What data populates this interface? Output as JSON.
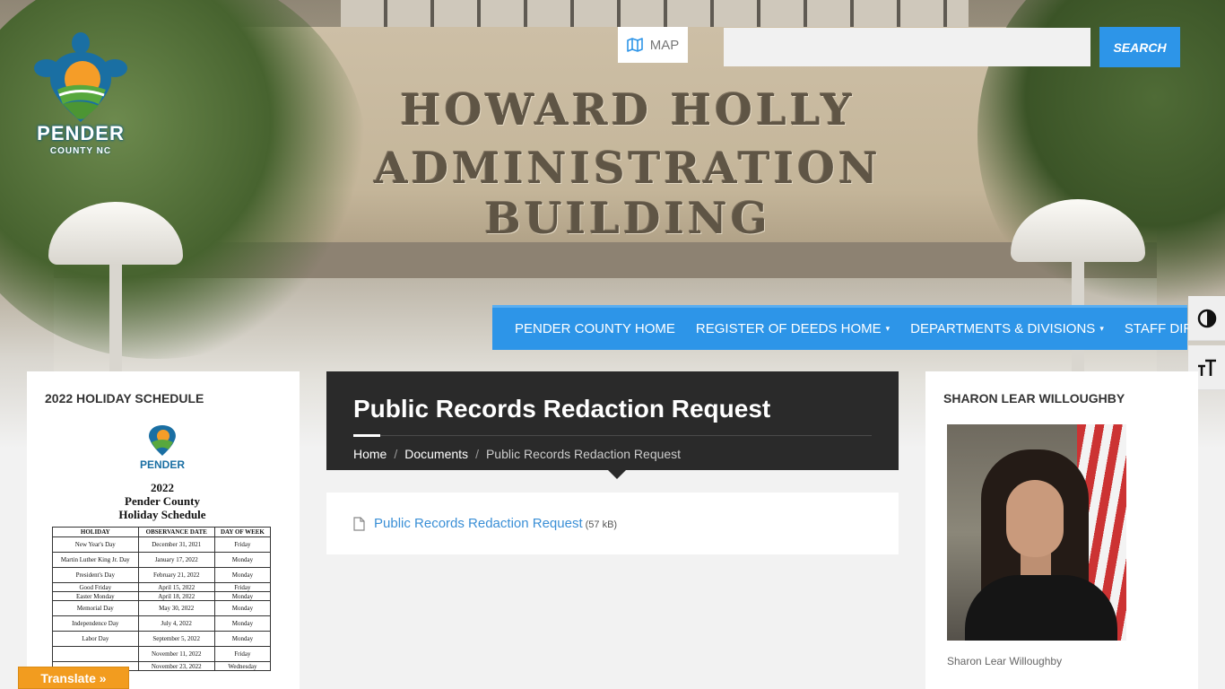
{
  "header": {
    "logo_text": "PENDER",
    "logo_subtext": "COUNTY NC",
    "building_line1": "HOWARD HOLLY",
    "building_line2": "ADMINISTRATION BUILDING",
    "map_label": "MAP",
    "search_placeholder": "",
    "search_button": "SEARCH"
  },
  "nav": {
    "items": [
      {
        "label": "PENDER COUNTY HOME"
      },
      {
        "label": "REGISTER OF DEEDS HOME"
      },
      {
        "label": "DEPARTMENTS & DIVISIONS"
      },
      {
        "label": "STAFF DIRECTORY"
      }
    ]
  },
  "left_sidebar": {
    "title": "2022 HOLIDAY SCHEDULE",
    "schedule": {
      "logo_text": "PENDER",
      "year": "2022",
      "line1": "Pender County",
      "line2": "Holiday Schedule",
      "headers": [
        "HOLIDAY",
        "OBSERVANCE DATE",
        "DAY OF WEEK"
      ],
      "rows": [
        {
          "holiday": "New Year's Day",
          "date": "December 31, 2021",
          "day": "Friday"
        },
        {
          "holiday": "Martin Luther King Jr. Day",
          "date": "January 17, 2022",
          "day": "Monday"
        },
        {
          "holiday": "President's Day",
          "date": "February 21, 2022",
          "day": "Monday"
        },
        {
          "holiday": "Good Friday",
          "date": "April 15, 2022",
          "day": "Friday"
        },
        {
          "holiday": "Easter Monday",
          "date": "April 18, 2022",
          "day": "Monday"
        },
        {
          "holiday": "Memorial Day",
          "date": "May 30, 2022",
          "day": "Monday"
        },
        {
          "holiday": "Independence Day",
          "date": "July 4, 2022",
          "day": "Monday"
        },
        {
          "holiday": "Labor Day",
          "date": "September 5, 2022",
          "day": "Monday"
        },
        {
          "holiday": "",
          "date": "November 11, 2022",
          "day": "Friday"
        },
        {
          "holiday": "",
          "date": "November 23, 2022",
          "day": "Wednesday"
        }
      ]
    }
  },
  "main": {
    "title": "Public Records Redaction Request",
    "breadcrumb": {
      "home": "Home",
      "documents": "Documents",
      "current": "Public Records Redaction Request",
      "separator": "/"
    },
    "document": {
      "link": "Public Records Redaction Request",
      "size": "(57 kB)"
    }
  },
  "right_sidebar": {
    "title": "SHARON LEAR WILLOUGHBY",
    "caption": "Sharon Lear Willoughby"
  },
  "translate": {
    "label": "Translate »"
  },
  "colors": {
    "accent": "#2d95e8",
    "header_dark": "#2a2a2a",
    "link": "#3a8fd6",
    "translate": "#f29c1f"
  }
}
